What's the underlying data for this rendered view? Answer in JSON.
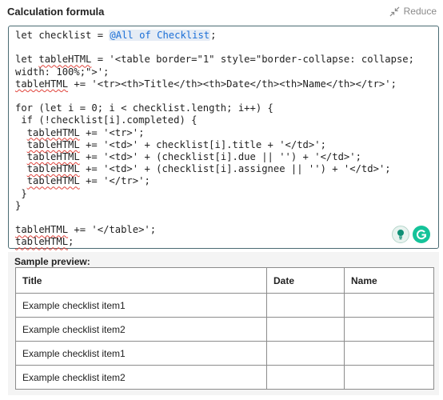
{
  "header": {
    "title": "Calculation formula",
    "reduce_label": "Reduce"
  },
  "editor": {
    "token": "@All of Checklist"
  },
  "preview": {
    "label": "Sample preview:",
    "columns": [
      "Title",
      "Date",
      "Name"
    ],
    "rows": [
      [
        "Example checklist item1",
        "",
        ""
      ],
      [
        "Example checklist item2",
        "",
        ""
      ],
      [
        "Example checklist item1",
        "",
        ""
      ],
      [
        "Example checklist item2",
        "",
        ""
      ]
    ]
  },
  "icons": {
    "reduce": "collapse-arrows-icon",
    "grammarly_bulb": "lightbulb-icon",
    "grammarly": "grammarly-g-icon"
  },
  "colors": {
    "editor_border": "#4a6b73",
    "token_text": "#1b6fd6",
    "token_bg": "#e5ecf5",
    "spell_underline": "#e0433b",
    "grammarly_green": "#15c39a"
  }
}
